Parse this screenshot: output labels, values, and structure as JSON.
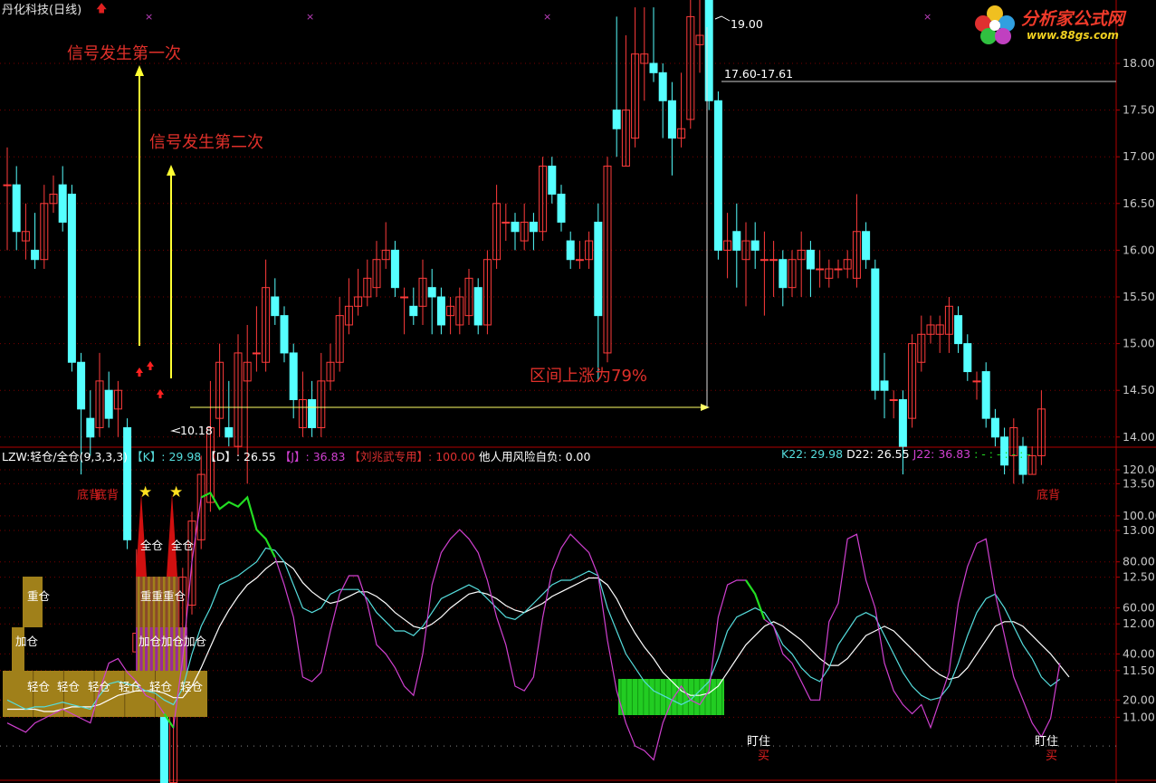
{
  "window": {
    "title": "丹化科技(日线)",
    "title_arrow": "🡅"
  },
  "logo": {
    "name": "分析家公式网",
    "url": "www.88gs.com"
  },
  "annotations": {
    "signal_first": "信号发生第一次",
    "signal_second": "信号发生第二次",
    "range_rise": "区间上涨为79%",
    "high_label": "19.00",
    "low_label": "10.18",
    "target_line": "17.60-17.61"
  },
  "indicator_bar": {
    "name": "LZW:轻仓/全仓(9,3,3,3)",
    "k_label": "【K】",
    "k_value": ": 29.98",
    "d_label": "【D】",
    "d_value": ": 26.55",
    "j_label": "【J】",
    "j_value": ": 36.83",
    "liu_label": "【刘兆武专用】",
    "liu_value": ": 100.00",
    "risk": "他人用风险自负: 0.00",
    "k22": "K22: 29.98",
    "d22": "D22: 26.55",
    "j22": "J22: 36.83",
    "dashes": ": - : - : - : -"
  },
  "colors": {
    "up": "#ff3b3b",
    "down": "#55ffff",
    "k_line": "#55dddd",
    "d_line": "#ffffff",
    "j_line": "#d040d0",
    "grid": "#7a0000",
    "gold": "#a0801a",
    "lime": "#22dd22"
  },
  "price_axis": [
    "18.00",
    "17.50",
    "17.00",
    "16.50",
    "16.00",
    "15.50",
    "15.00",
    "14.50",
    "14.00",
    "13.50",
    "13.00",
    "12.50",
    "12.00",
    "11.50",
    "11.00"
  ],
  "indicator_axis": [
    "120.00",
    "100.00",
    "80.00",
    "60.00",
    "40.00",
    "20.00"
  ],
  "position_labels": {
    "light": "轻仓",
    "add": "加仓",
    "heavy": "重仓",
    "heavy_triple": "重重重仓",
    "full": "全仓",
    "add_triple": "加仓加仓加仓",
    "divergence_left": "底背",
    "divergence_right": "底背",
    "watch": "盯住",
    "buy": "买",
    "star": "★"
  },
  "candles": [
    {
      "o": 16.7,
      "c": 16.7,
      "h": 17.1,
      "l": 16.0
    },
    {
      "o": 16.7,
      "c": 16.2,
      "h": 16.9,
      "l": 16.0
    },
    {
      "o": 16.1,
      "c": 16.2,
      "h": 16.5,
      "l": 15.9
    },
    {
      "o": 16.0,
      "c": 15.9,
      "h": 16.4,
      "l": 15.8
    },
    {
      "o": 15.9,
      "c": 16.5,
      "h": 16.7,
      "l": 15.8
    },
    {
      "o": 16.5,
      "c": 16.6,
      "h": 16.8,
      "l": 16.4
    },
    {
      "o": 16.7,
      "c": 16.3,
      "h": 16.9,
      "l": 16.2
    },
    {
      "o": 16.6,
      "c": 14.8,
      "h": 16.7,
      "l": 14.7
    },
    {
      "o": 14.8,
      "c": 14.3,
      "h": 14.9,
      "l": 13.6
    },
    {
      "o": 14.2,
      "c": 14.0,
      "h": 14.5,
      "l": 13.8
    },
    {
      "o": 14.1,
      "c": 14.6,
      "h": 14.9,
      "l": 14.0
    },
    {
      "o": 14.5,
      "c": 14.2,
      "h": 14.7,
      "l": 14.1
    },
    {
      "o": 14.3,
      "c": 14.5,
      "h": 14.6,
      "l": 14.0
    },
    {
      "o": 14.1,
      "c": 12.9,
      "h": 14.2,
      "l": 12.8
    },
    {
      "o": 11.7,
      "c": 11.9,
      "h": 12.8,
      "l": 11.6
    },
    {
      "o": 11.9,
      "c": 12.0,
      "h": 12.1,
      "l": 11.7
    },
    {
      "o": 12.0,
      "c": 11.6,
      "h": 12.1,
      "l": 11.5
    },
    {
      "o": 11.0,
      "c": 10.3,
      "h": 11.3,
      "l": 10.2
    },
    {
      "o": 10.3,
      "c": 11.4,
      "h": 11.5,
      "l": 10.2
    },
    {
      "o": 11.3,
      "c": 12.5,
      "h": 12.6,
      "l": 11.2
    },
    {
      "o": 12.2,
      "c": 13.1,
      "h": 13.2,
      "l": 12.1
    },
    {
      "o": 12.9,
      "c": 13.6,
      "h": 13.8,
      "l": 12.8
    },
    {
      "o": 13.3,
      "c": 14.1,
      "h": 14.6,
      "l": 13.2
    },
    {
      "o": 14.2,
      "c": 14.8,
      "h": 15.0,
      "l": 14.0
    },
    {
      "o": 14.1,
      "c": 14.0,
      "h": 14.6,
      "l": 13.9
    },
    {
      "o": 13.9,
      "c": 14.9,
      "h": 15.1,
      "l": 13.8
    },
    {
      "o": 14.6,
      "c": 14.8,
      "h": 15.2,
      "l": 13.5
    },
    {
      "o": 14.9,
      "c": 14.9,
      "h": 15.4,
      "l": 14.7
    },
    {
      "o": 14.8,
      "c": 15.6,
      "h": 15.9,
      "l": 14.7
    },
    {
      "o": 15.5,
      "c": 15.3,
      "h": 15.7,
      "l": 15.2
    },
    {
      "o": 15.3,
      "c": 14.9,
      "h": 15.4,
      "l": 14.8
    },
    {
      "o": 14.9,
      "c": 14.4,
      "h": 15.0,
      "l": 14.2
    },
    {
      "o": 14.1,
      "c": 14.4,
      "h": 14.7,
      "l": 14.0
    },
    {
      "o": 14.4,
      "c": 14.1,
      "h": 14.6,
      "l": 14.0
    },
    {
      "o": 14.1,
      "c": 14.6,
      "h": 14.9,
      "l": 14.0
    },
    {
      "o": 14.6,
      "c": 14.8,
      "h": 15.0,
      "l": 14.5
    },
    {
      "o": 14.8,
      "c": 15.3,
      "h": 15.5,
      "l": 14.7
    },
    {
      "o": 15.2,
      "c": 15.4,
      "h": 15.7,
      "l": 15.1
    },
    {
      "o": 15.4,
      "c": 15.5,
      "h": 15.8,
      "l": 15.3
    },
    {
      "o": 15.5,
      "c": 15.7,
      "h": 15.9,
      "l": 15.4
    },
    {
      "o": 15.6,
      "c": 15.9,
      "h": 16.1,
      "l": 15.5
    },
    {
      "o": 15.9,
      "c": 16.0,
      "h": 16.3,
      "l": 15.8
    },
    {
      "o": 16.0,
      "c": 15.6,
      "h": 16.1,
      "l": 15.5
    },
    {
      "o": 15.5,
      "c": 15.5,
      "h": 15.6,
      "l": 15.1
    },
    {
      "o": 15.4,
      "c": 15.3,
      "h": 15.6,
      "l": 15.2
    },
    {
      "o": 15.4,
      "c": 15.7,
      "h": 15.9,
      "l": 15.2
    },
    {
      "o": 15.6,
      "c": 15.5,
      "h": 15.8,
      "l": 15.1
    },
    {
      "o": 15.5,
      "c": 15.2,
      "h": 15.6,
      "l": 15.1
    },
    {
      "o": 15.3,
      "c": 15.4,
      "h": 15.5,
      "l": 15.1
    },
    {
      "o": 15.2,
      "c": 15.5,
      "h": 15.6,
      "l": 15.1
    },
    {
      "o": 15.3,
      "c": 15.7,
      "h": 15.8,
      "l": 15.2
    },
    {
      "o": 15.6,
      "c": 15.2,
      "h": 15.7,
      "l": 15.1
    },
    {
      "o": 15.2,
      "c": 15.9,
      "h": 16.0,
      "l": 15.1
    },
    {
      "o": 15.9,
      "c": 16.5,
      "h": 16.7,
      "l": 15.8
    },
    {
      "o": 16.3,
      "c": 16.3,
      "h": 16.5,
      "l": 16.1
    },
    {
      "o": 16.3,
      "c": 16.2,
      "h": 16.4,
      "l": 16.0
    },
    {
      "o": 16.1,
      "c": 16.3,
      "h": 16.5,
      "l": 16.0
    },
    {
      "o": 16.3,
      "c": 16.2,
      "h": 16.4,
      "l": 16.0
    },
    {
      "o": 16.2,
      "c": 16.9,
      "h": 17.0,
      "l": 16.1
    },
    {
      "o": 16.9,
      "c": 16.6,
      "h": 17.0,
      "l": 16.5
    },
    {
      "o": 16.6,
      "c": 16.3,
      "h": 16.7,
      "l": 16.2
    },
    {
      "o": 16.1,
      "c": 15.9,
      "h": 16.2,
      "l": 15.8
    },
    {
      "o": 15.9,
      "c": 15.9,
      "h": 16.1,
      "l": 15.8
    },
    {
      "o": 15.9,
      "c": 16.1,
      "h": 16.2,
      "l": 15.8
    },
    {
      "o": 16.3,
      "c": 15.3,
      "h": 16.5,
      "l": 14.6
    },
    {
      "o": 14.9,
      "c": 16.9,
      "h": 17.0,
      "l": 14.8
    },
    {
      "o": 17.5,
      "c": 17.3,
      "h": 18.5,
      "l": 17.0
    },
    {
      "o": 16.9,
      "c": 17.5,
      "h": 18.3,
      "l": 16.9
    },
    {
      "o": 17.2,
      "c": 18.1,
      "h": 18.6,
      "l": 17.1
    },
    {
      "o": 18.0,
      "c": 18.1,
      "h": 18.6,
      "l": 17.6
    },
    {
      "o": 18.0,
      "c": 17.9,
      "h": 18.6,
      "l": 17.8
    },
    {
      "o": 17.9,
      "c": 17.6,
      "h": 18.0,
      "l": 17.2
    },
    {
      "o": 17.6,
      "c": 17.2,
      "h": 17.8,
      "l": 16.8
    },
    {
      "o": 17.2,
      "c": 17.3,
      "h": 17.9,
      "l": 17.1
    },
    {
      "o": 17.4,
      "c": 18.5,
      "h": 18.8,
      "l": 17.3
    },
    {
      "o": 18.2,
      "c": 18.3,
      "h": 18.7,
      "l": 17.9
    },
    {
      "o": 18.8,
      "c": 17.6,
      "h": 19.0,
      "l": 17.5
    },
    {
      "o": 17.6,
      "c": 16.0,
      "h": 17.7,
      "l": 15.9
    },
    {
      "o": 16.0,
      "c": 16.1,
      "h": 16.4,
      "l": 15.7
    },
    {
      "o": 16.2,
      "c": 16.0,
      "h": 16.5,
      "l": 15.6
    },
    {
      "o": 15.9,
      "c": 16.1,
      "h": 16.3,
      "l": 15.4
    },
    {
      "o": 16.1,
      "c": 16.0,
      "h": 16.3,
      "l": 15.8
    },
    {
      "o": 15.9,
      "c": 15.9,
      "h": 16.2,
      "l": 15.3
    },
    {
      "o": 15.9,
      "c": 15.9,
      "h": 16.1,
      "l": 15.5
    },
    {
      "o": 15.9,
      "c": 15.6,
      "h": 16.0,
      "l": 15.4
    },
    {
      "o": 15.6,
      "c": 15.9,
      "h": 16.0,
      "l": 15.5
    },
    {
      "o": 15.9,
      "c": 16.0,
      "h": 16.2,
      "l": 15.5
    },
    {
      "o": 16.0,
      "c": 15.8,
      "h": 16.1,
      "l": 15.5
    },
    {
      "o": 15.8,
      "c": 15.8,
      "h": 16.0,
      "l": 15.6
    },
    {
      "o": 15.7,
      "c": 15.8,
      "h": 15.9,
      "l": 15.6
    },
    {
      "o": 15.8,
      "c": 15.8,
      "h": 15.9,
      "l": 15.7
    },
    {
      "o": 15.8,
      "c": 15.9,
      "h": 16.0,
      "l": 15.7
    },
    {
      "o": 15.7,
      "c": 16.2,
      "h": 16.6,
      "l": 15.6
    },
    {
      "o": 16.2,
      "c": 15.9,
      "h": 16.3,
      "l": 15.8
    },
    {
      "o": 15.8,
      "c": 14.5,
      "h": 15.9,
      "l": 14.4
    },
    {
      "o": 14.6,
      "c": 14.5,
      "h": 14.9,
      "l": 14.2
    },
    {
      "o": 14.4,
      "c": 14.4,
      "h": 14.5,
      "l": 14.2
    },
    {
      "o": 14.4,
      "c": 13.9,
      "h": 14.5,
      "l": 13.6
    },
    {
      "o": 14.2,
      "c": 15.0,
      "h": 15.1,
      "l": 14.1
    },
    {
      "o": 14.8,
      "c": 15.1,
      "h": 15.3,
      "l": 14.7
    },
    {
      "o": 15.1,
      "c": 15.2,
      "h": 15.3,
      "l": 15.0
    },
    {
      "o": 15.1,
      "c": 15.2,
      "h": 15.3,
      "l": 14.9
    },
    {
      "o": 15.1,
      "c": 15.4,
      "h": 15.5,
      "l": 14.9
    },
    {
      "o": 15.3,
      "c": 15.0,
      "h": 15.4,
      "l": 14.9
    },
    {
      "o": 15.0,
      "c": 14.7,
      "h": 15.1,
      "l": 14.6
    },
    {
      "o": 14.6,
      "c": 14.6,
      "h": 14.7,
      "l": 14.4
    },
    {
      "o": 14.7,
      "c": 14.2,
      "h": 14.8,
      "l": 14.1
    },
    {
      "o": 14.2,
      "c": 14.0,
      "h": 14.3,
      "l": 13.9
    },
    {
      "o": 14.0,
      "c": 13.7,
      "h": 14.1,
      "l": 13.6
    },
    {
      "o": 13.8,
      "c": 14.1,
      "h": 14.2,
      "l": 13.5
    },
    {
      "o": 13.9,
      "c": 13.6,
      "h": 14.0,
      "l": 13.5
    },
    {
      "o": 13.6,
      "c": 13.8,
      "h": 13.9,
      "l": 13.6
    },
    {
      "o": 13.8,
      "c": 14.3,
      "h": 14.5,
      "l": 13.7
    }
  ],
  "indicator": {
    "k": [
      20,
      18,
      16,
      17,
      17,
      18,
      19,
      18,
      17,
      16,
      22,
      27,
      28,
      27,
      26,
      24,
      23,
      20,
      18,
      25,
      40,
      52,
      60,
      70,
      72,
      74,
      77,
      80,
      86,
      85,
      80,
      70,
      60,
      58,
      60,
      66,
      68,
      68,
      68,
      64,
      58,
      54,
      50,
      50,
      48,
      52,
      58,
      64,
      66,
      68,
      70,
      68,
      64,
      60,
      56,
      55,
      58,
      62,
      66,
      70,
      72,
      72,
      74,
      76,
      74,
      60,
      50,
      40,
      34,
      28,
      24,
      22,
      20,
      18,
      20,
      24,
      28,
      38,
      50,
      56,
      58,
      60,
      58,
      52,
      44,
      40,
      34,
      30,
      28,
      34,
      44,
      50,
      56,
      58,
      56,
      48,
      40,
      32,
      26,
      22,
      20,
      21,
      26,
      36,
      48,
      58,
      64,
      66,
      60,
      52,
      44,
      38,
      30,
      26,
      29
    ],
    "d": [
      16,
      16,
      16,
      16,
      15,
      15,
      16,
      17,
      17,
      17,
      18,
      20,
      22,
      23,
      24,
      24,
      24,
      23,
      21,
      21,
      26,
      34,
      43,
      52,
      59,
      65,
      70,
      73,
      77,
      80,
      80,
      77,
      71,
      67,
      64,
      62,
      63,
      65,
      67,
      67,
      65,
      62,
      58,
      55,
      52,
      51,
      53,
      56,
      60,
      63,
      66,
      67,
      66,
      64,
      61,
      59,
      58,
      60,
      62,
      65,
      67,
      69,
      71,
      73,
      73,
      70,
      64,
      56,
      49,
      43,
      38,
      32,
      28,
      24,
      22,
      22,
      23,
      26,
      32,
      38,
      44,
      48,
      52,
      54,
      52,
      49,
      46,
      42,
      38,
      35,
      35,
      38,
      43,
      48,
      50,
      52,
      50,
      46,
      42,
      38,
      34,
      31,
      29,
      30,
      34,
      40,
      46,
      52,
      54,
      54,
      52,
      48,
      44,
      40,
      35,
      30
    ],
    "j": [
      10,
      8,
      6,
      10,
      12,
      14,
      16,
      14,
      12,
      10,
      24,
      36,
      38,
      32,
      28,
      22,
      20,
      14,
      8,
      38,
      80,
      108,
      110,
      103,
      106,
      104,
      108,
      94,
      90,
      82,
      70,
      56,
      30,
      28,
      32,
      50,
      66,
      74,
      74,
      62,
      44,
      40,
      34,
      26,
      22,
      40,
      70,
      84,
      90,
      94,
      90,
      84,
      72,
      56,
      44,
      26,
      24,
      30,
      56,
      76,
      86,
      92,
      88,
      84,
      74,
      46,
      24,
      10,
      0,
      -2,
      -6,
      10,
      20,
      26,
      20,
      18,
      24,
      56,
      70,
      72,
      72,
      66,
      55,
      52,
      40,
      36,
      28,
      20,
      20,
      54,
      62,
      90,
      92,
      72,
      60,
      36,
      24,
      18,
      14,
      18,
      8,
      20,
      32,
      62,
      78,
      88,
      90,
      66,
      48,
      30,
      20,
      10,
      4,
      12,
      36
    ]
  },
  "scroll": {
    "dots": [
      "×",
      "×",
      "×",
      "×",
      "×",
      "×"
    ]
  }
}
